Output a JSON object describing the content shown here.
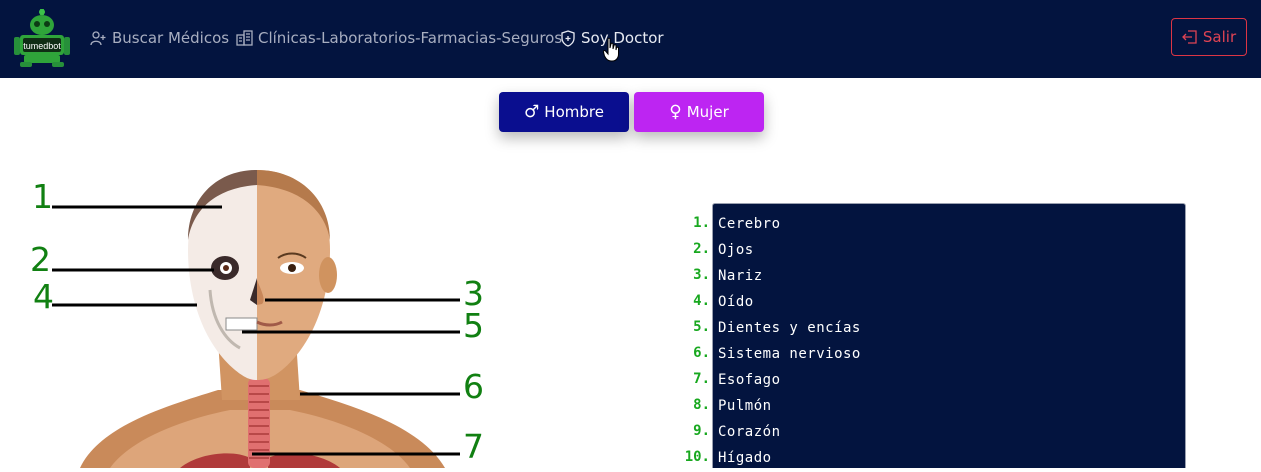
{
  "navbar": {
    "logo_text": "tumedbot",
    "links": [
      {
        "label": "Buscar Médicos",
        "icon": "user-plus-icon"
      },
      {
        "label": "Clínicas-Laboratorios-Farmacias-Seguros",
        "icon": "building-icon"
      },
      {
        "label": "Soy Doctor",
        "icon": "shield-plus-icon"
      }
    ],
    "logout_label": "Salir"
  },
  "gender": {
    "male_symbol": "♂",
    "male_label": "Hombre",
    "female_symbol": "♀",
    "female_label": "Mujer"
  },
  "anatomy": {
    "labels": [
      "1",
      "2",
      "4",
      "3",
      "5",
      "6",
      "7"
    ]
  },
  "organs": [
    {
      "num": "1.",
      "name": "Cerebro"
    },
    {
      "num": "2.",
      "name": "Ojos"
    },
    {
      "num": "3.",
      "name": "Nariz"
    },
    {
      "num": "4.",
      "name": "Oído"
    },
    {
      "num": "5.",
      "name": "Dientes y encías"
    },
    {
      "num": "6.",
      "name": "Sistema nervioso"
    },
    {
      "num": "7.",
      "name": "Esofago"
    },
    {
      "num": "8.",
      "name": "Pulmón"
    },
    {
      "num": "9.",
      "name": "Corazón"
    },
    {
      "num": "10.",
      "name": "Hígado"
    }
  ],
  "colors": {
    "navbar_bg": "#03143f",
    "male_btn": "#0a0e8f",
    "female_btn": "#bd25f2",
    "logout": "#dc3545",
    "label_green": "#118012"
  }
}
